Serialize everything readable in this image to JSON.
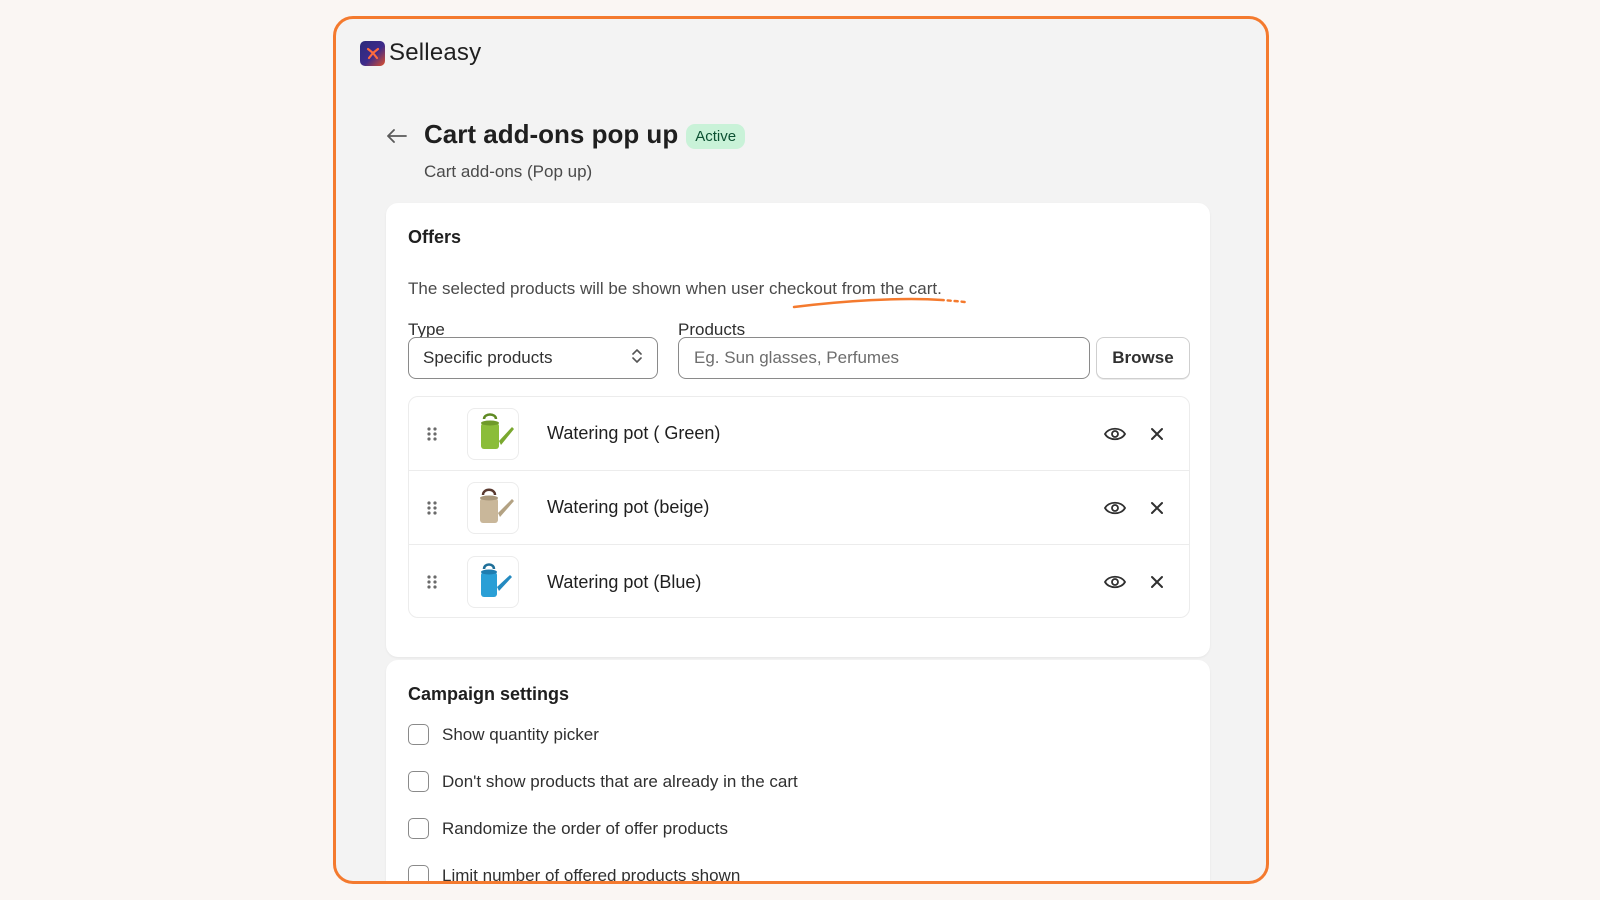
{
  "brand": {
    "name": "Selleasy"
  },
  "header": {
    "title": "Cart add-ons pop up",
    "status_badge": "Active",
    "subtitle": "Cart add-ons (Pop up)"
  },
  "offers": {
    "title": "Offers",
    "description": "The selected products will be shown when user checkout from the cart.",
    "type_label": "Type",
    "type_value": "Specific products",
    "products_label": "Products",
    "products_placeholder": "Eg. Sun glasses, Perfumes",
    "browse_label": "Browse",
    "products": [
      {
        "name": "Watering pot ( Green)",
        "color": "#8bbd3a"
      },
      {
        "name": "Watering pot (beige)",
        "color": "#c9b79a"
      },
      {
        "name": "Watering pot (Blue)",
        "color": "#2a9fd6"
      }
    ]
  },
  "campaign": {
    "title": "Campaign settings",
    "options": [
      {
        "label": "Show quantity picker",
        "checked": false
      },
      {
        "label": "Don't show products that are already in the cart",
        "checked": false
      },
      {
        "label": "Randomize the order of offer products",
        "checked": false
      },
      {
        "label": "Limit number of offered products shown",
        "checked": false
      }
    ]
  },
  "colors": {
    "frame_border": "#f47a2e",
    "badge_bg": "#c9f2d8",
    "annotation": "#f47a2e"
  }
}
